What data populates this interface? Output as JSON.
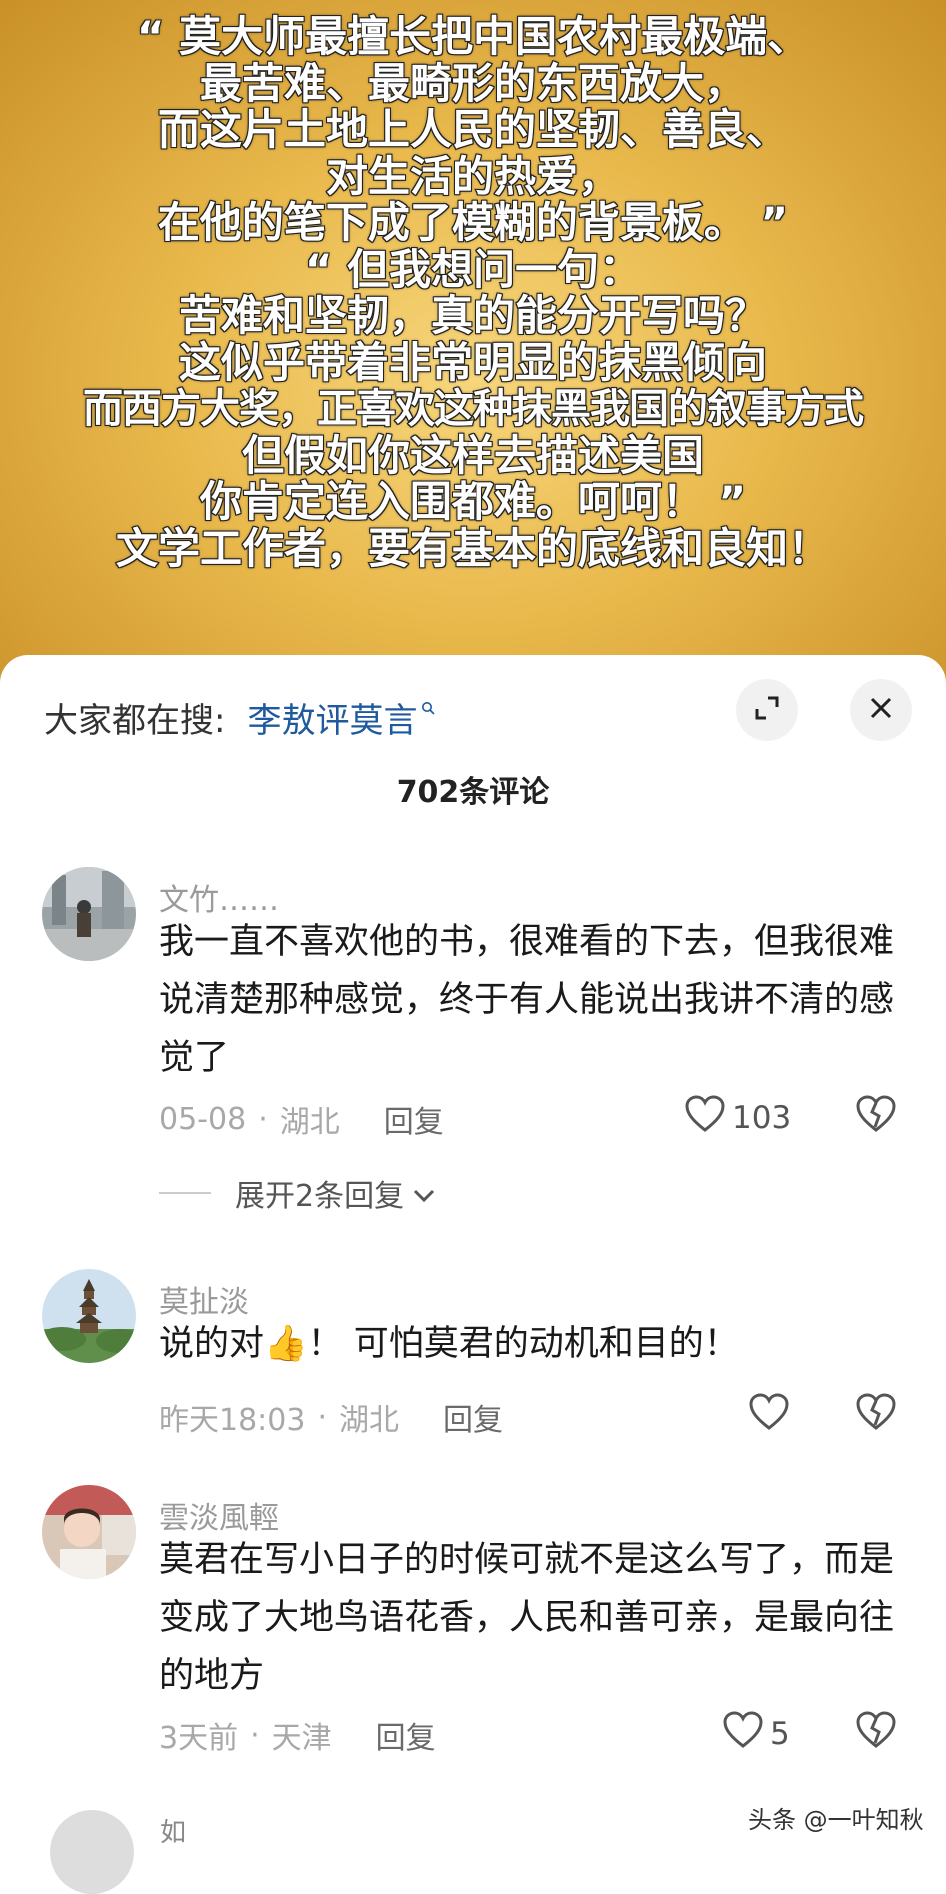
{
  "banner": {
    "lines": [
      "“ 莫大师最擅长把中国农村最极端、",
      "最苦难、最畸形的东西放大，",
      "而这片土地上人民的坚韧、善良、",
      "对生活的热爱，",
      "在他的笔下成了模糊的背景板。 ”",
      "“ 但我想问一句：",
      "苦难和坚韧，真的能分开写吗？",
      "这似乎带着非常明显的抹黑倾向",
      "而西方大奖，正喜欢这种抹黑我国的叙事方式",
      "但假如你这样去描述美国",
      "你肯定连入围都难。呵呵！ ”",
      "文学工作者，要有基本的底线和良知！"
    ]
  },
  "search": {
    "label": "大家都在搜:",
    "query": "李敖评莫言"
  },
  "comments_header": {
    "count_label": "702条评论"
  },
  "comments": [
    {
      "username": "文竹……",
      "text": "我一直不喜欢他的书，很难看的下去，但我很难说清楚那种感觉，终于有人能说出我讲不清的感觉了",
      "date": "05-08",
      "location": "湖北",
      "reply_label": "回复",
      "likes": "103",
      "expand_label": "展开2条回复"
    },
    {
      "username": "莫扯淡",
      "text_before_emoji": "说的对",
      "text_after_emoji": "！ 可怕莫君的动机和目的！",
      "emoji": "👍",
      "date": "昨天18:03",
      "location": "湖北",
      "reply_label": "回复",
      "likes": ""
    },
    {
      "username": "雲淡風輕",
      "text": "莫君在写小日子的时候可就不是这么写了，而是变成了大地鸟语花香，人民和善可亲，是最向往的地方",
      "date": "3天前",
      "location": "天津",
      "reply_label": "回复",
      "likes": "5"
    }
  ],
  "peek_username": "如",
  "watermark": "头条 @一叶知秋",
  "icons": {
    "expand": "expand-icon",
    "close": "close-icon",
    "like": "heart-icon",
    "dislike": "broken-heart-icon",
    "search": "search-icon",
    "chevron": "chevron-down-icon"
  },
  "colors": {
    "link": "#1f5a9e",
    "banner": "#e9b94c"
  }
}
